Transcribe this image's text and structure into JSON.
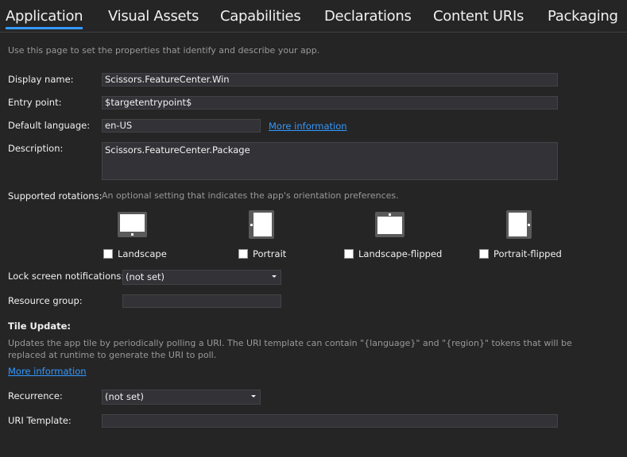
{
  "tabs": [
    {
      "label": "Application",
      "active": true
    },
    {
      "label": "Visual Assets",
      "active": false
    },
    {
      "label": "Capabilities",
      "active": false
    },
    {
      "label": "Declarations",
      "active": false
    },
    {
      "label": "Content URIs",
      "active": false
    },
    {
      "label": "Packaging",
      "active": false
    }
  ],
  "intro": "Use this page to set the properties that identify and describe your app.",
  "fields": {
    "display_name": {
      "label": "Display name:",
      "value": "Scissors.FeatureCenter.Win"
    },
    "entry_point": {
      "label": "Entry point:",
      "value": "$targetentrypoint$"
    },
    "default_language": {
      "label": "Default language:",
      "value": "en-US",
      "link": "More information"
    },
    "description": {
      "label": "Description:",
      "value": "Scissors.FeatureCenter.Package"
    }
  },
  "rotations": {
    "label": "Supported rotations:",
    "hint": "An optional setting that indicates the app's orientation preferences.",
    "options": [
      {
        "label": "Landscape",
        "icon": "tablet-landscape-icon",
        "checked": false
      },
      {
        "label": "Portrait",
        "icon": "tablet-portrait-icon",
        "checked": false
      },
      {
        "label": "Landscape-flipped",
        "icon": "tablet-landscape-flipped-icon",
        "checked": false
      },
      {
        "label": "Portrait-flipped",
        "icon": "tablet-portrait-flipped-icon",
        "checked": false
      }
    ]
  },
  "lock_screen": {
    "label": "Lock screen notifications:",
    "value": "(not set)"
  },
  "resource_group": {
    "label": "Resource group:",
    "value": ""
  },
  "tile_update": {
    "heading": "Tile Update:",
    "description_line1": "Updates the app tile by periodically polling a URI. The URI template can contain \"{language}\" and \"{region}\" tokens that will be",
    "description_line2": "replaced at runtime to generate the URI to poll.",
    "link": "More information",
    "recurrence": {
      "label": "Recurrence:",
      "value": "(not set)"
    },
    "uri_template": {
      "label": "URI Template:",
      "value": ""
    }
  }
}
